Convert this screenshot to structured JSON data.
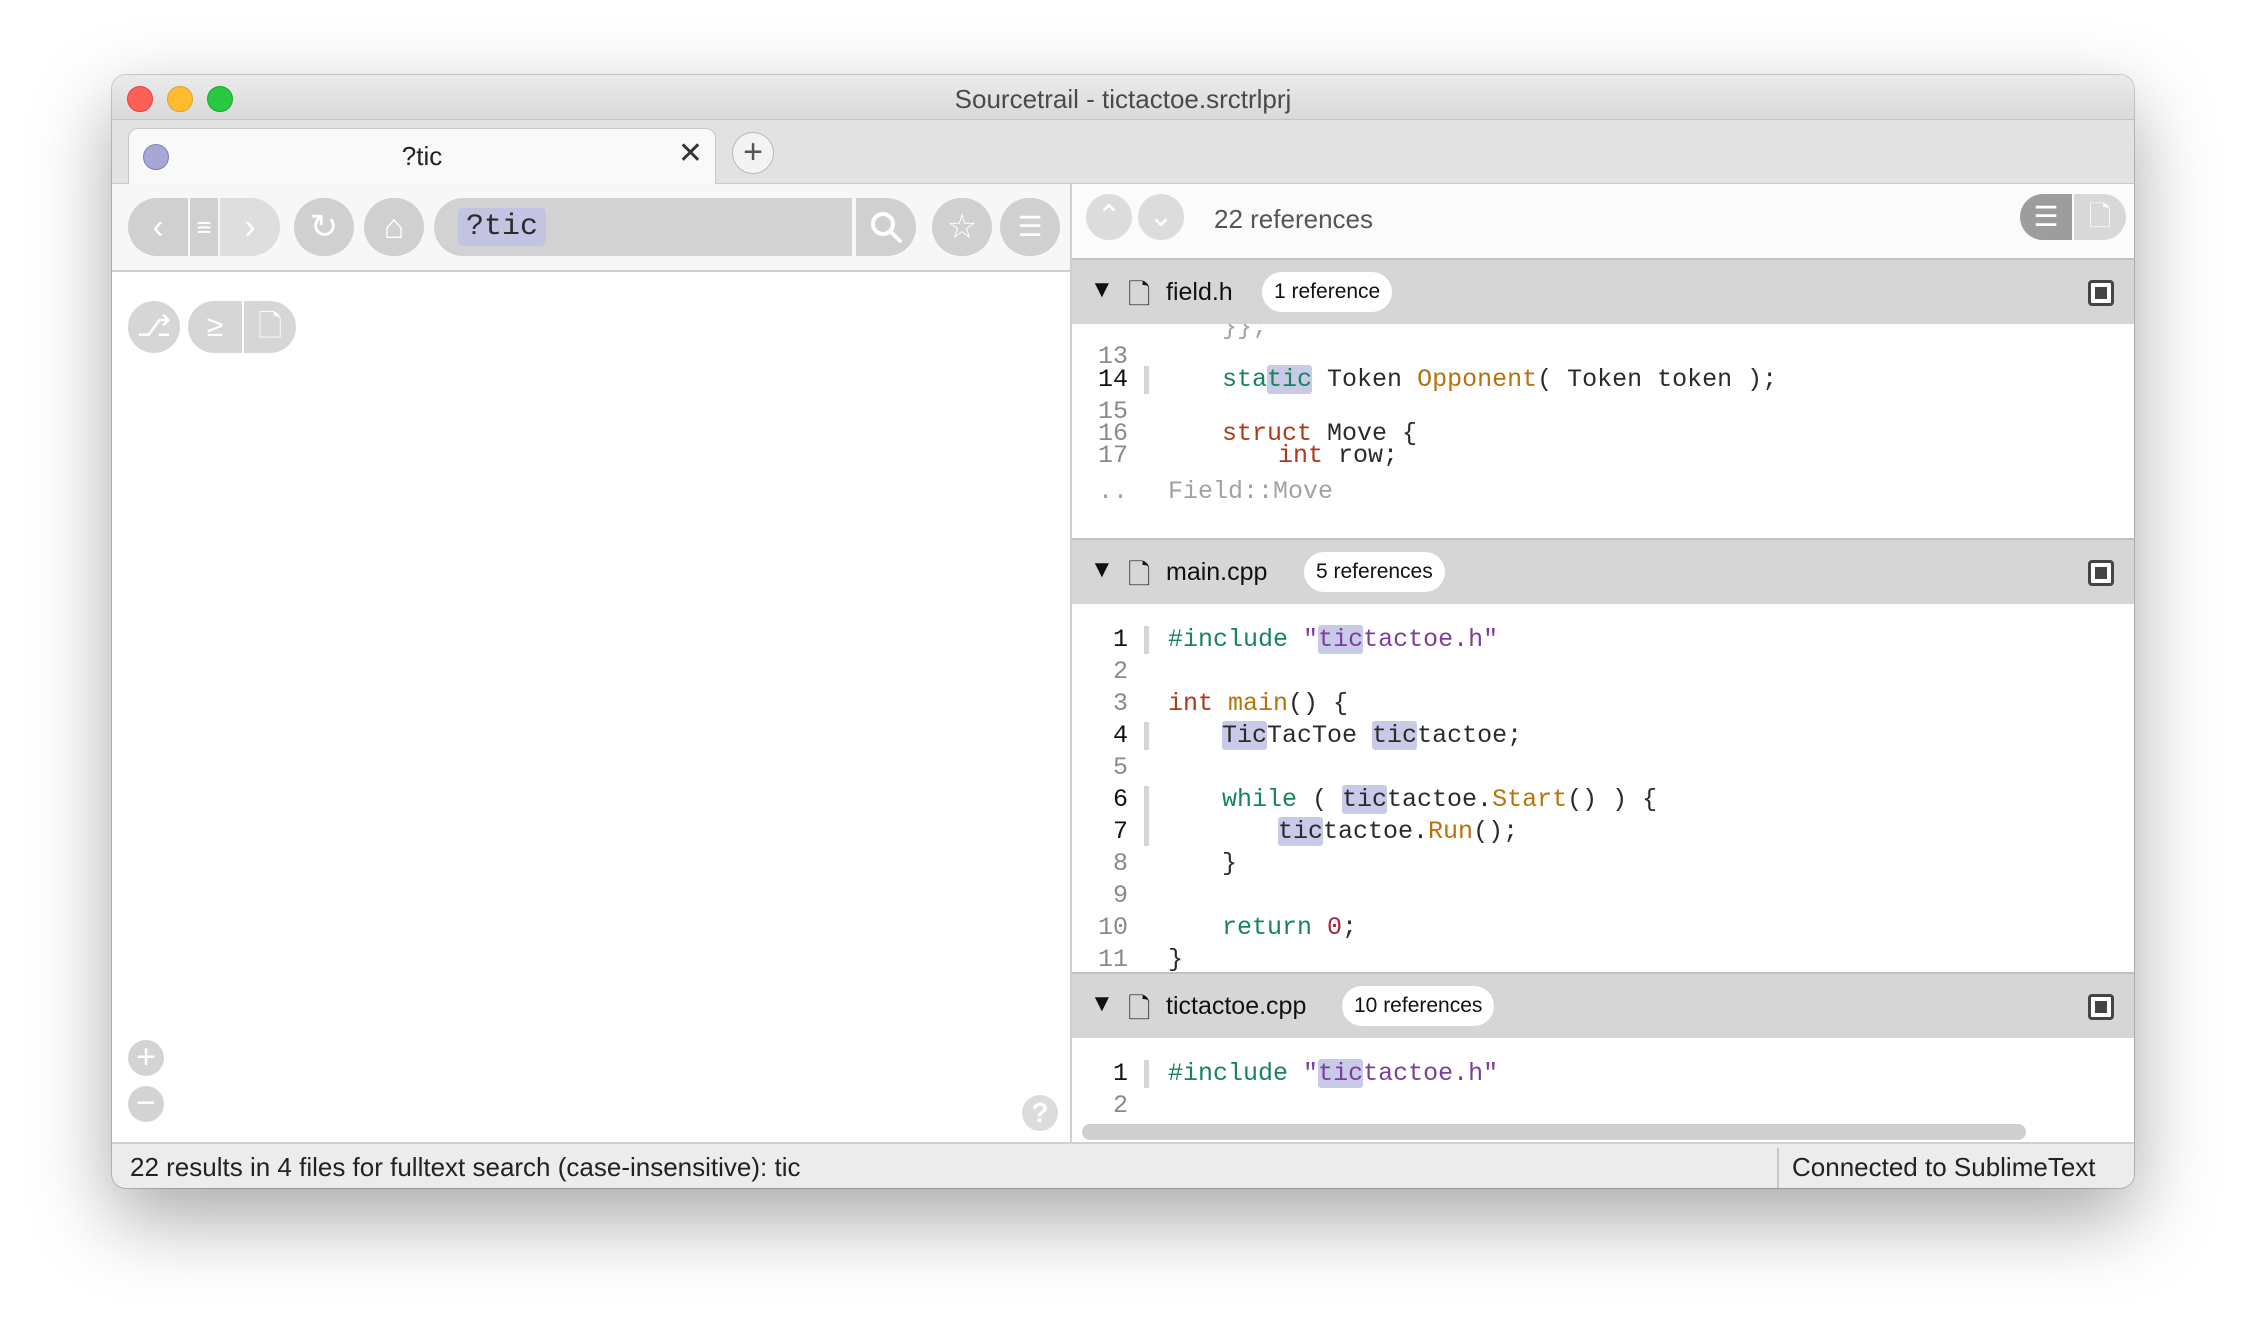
{
  "window": {
    "title": "Sourcetrail - tictactoe.srctrlprj"
  },
  "tabs": [
    {
      "label": "?tic",
      "close": "✕"
    }
  ],
  "tab_add": "+",
  "toolbar": {
    "back": "‹",
    "history": "≡",
    "forward": "›",
    "refresh": "↻",
    "home": "⌂",
    "search_query": "?tic",
    "search_icon": "🔍",
    "bookmark": "☆",
    "bookmarks_menu": "☰"
  },
  "graph_controls": {
    "graph": "⎇",
    "terminal": "≥",
    "file": "🗋"
  },
  "zoom": {
    "in": "+",
    "out": "−"
  },
  "help": "?",
  "code_view": {
    "reference_count": "22 references",
    "prev": "⌃",
    "next": "⌄",
    "files": [
      {
        "name": "field.h",
        "badge": "1 reference"
      },
      {
        "name": "main.cpp",
        "badge": "5 references"
      },
      {
        "name": "tictactoe.cpp",
        "badge": "10 references"
      }
    ],
    "field_h_lines": [
      "13",
      "14",
      "15",
      "16",
      "17",
      ".."
    ],
    "field_h_footer": "Field::Move",
    "main_lines": [
      "1",
      "2",
      "3",
      "4",
      "5",
      "6",
      "7",
      "8",
      "9",
      "10",
      "11"
    ],
    "tictactoe_lines": [
      "1",
      "2"
    ]
  },
  "status": {
    "left": "22 results in 4 files for fulltext search (case-insensitive): tic",
    "right": "Connected to SublimeText"
  },
  "colors": {
    "highlight": "#c9cae8",
    "keyword": "#b0381c",
    "preproc": "#17845c",
    "string": "#7b3f9b",
    "function": "#b8720b"
  }
}
